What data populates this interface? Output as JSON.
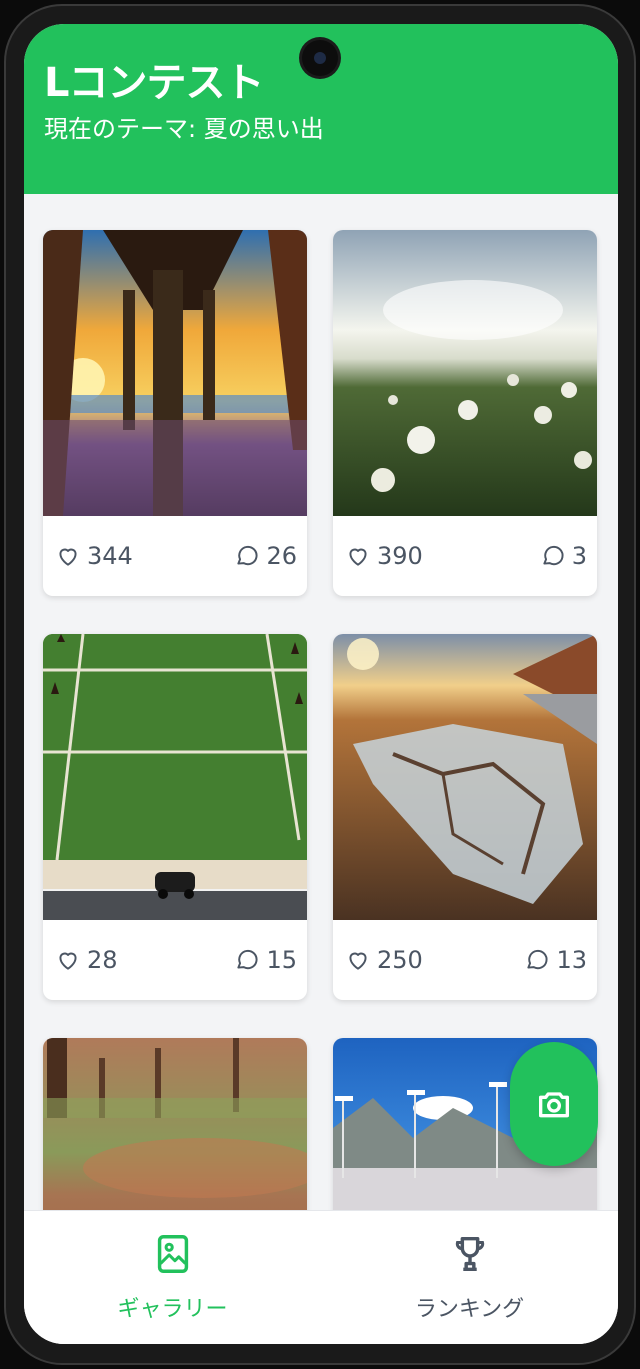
{
  "header": {
    "title": "Lコンテスト",
    "subtitle": "現在のテーマ: 夏の思い出"
  },
  "photos": [
    {
      "scene": "pier-sunset",
      "likes": "344",
      "comments": "26"
    },
    {
      "scene": "dandelion-field",
      "likes": "390",
      "comments": "3"
    },
    {
      "scene": "tennis-court-car",
      "likes": "28",
      "comments": "15"
    },
    {
      "scene": "cracked-road-sunset",
      "likes": "250",
      "comments": "13"
    },
    {
      "scene": "autumn-park"
    },
    {
      "scene": "mountains-lights"
    }
  ],
  "fab": {
    "icon": "camera-icon"
  },
  "bottom_nav": {
    "items": [
      {
        "label": "ギャラリー",
        "icon": "gallery-icon",
        "active": true
      },
      {
        "label": "ランキング",
        "icon": "trophy-icon",
        "active": false
      }
    ]
  },
  "colors": {
    "accent": "#22c15c",
    "background": "#f3f4f6",
    "text_muted": "#4b5563"
  }
}
